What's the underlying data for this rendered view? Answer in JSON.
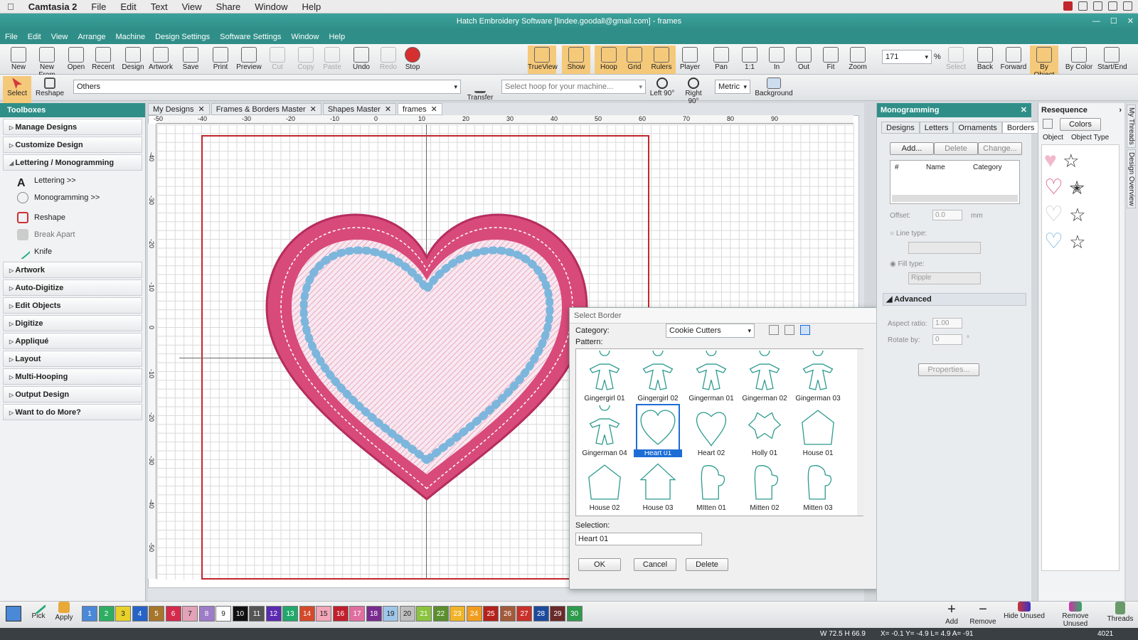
{
  "mac": {
    "apple": "",
    "app": "Camtasia 2",
    "menus": [
      "File",
      "Edit",
      "Text",
      "View",
      "Share",
      "Window",
      "Help"
    ]
  },
  "window": {
    "title": "Hatch Embroidery Software [lindee.goodall@gmail.com] - frames"
  },
  "menubar": [
    "File",
    "Edit",
    "View",
    "Arrange",
    "Machine",
    "Design Settings",
    "Software Settings",
    "Window",
    "Help"
  ],
  "toolbar": [
    {
      "label": "New",
      "icon": "new-icon"
    },
    {
      "label": "New From",
      "icon": "new-from-icon"
    },
    {
      "label": "Open",
      "icon": "open-icon"
    },
    {
      "label": "Recent",
      "icon": "recent-icon"
    },
    {
      "label": "Design",
      "icon": "design-icon"
    },
    {
      "label": "Artwork",
      "icon": "artwork-icon"
    },
    {
      "label": "Save",
      "icon": "save-icon"
    },
    {
      "label": "Print",
      "icon": "print-icon"
    },
    {
      "label": "Preview",
      "icon": "preview-icon"
    },
    {
      "label": "Cut",
      "icon": "cut-icon"
    },
    {
      "label": "Copy",
      "icon": "copy-icon"
    },
    {
      "label": "Paste",
      "icon": "paste-icon"
    },
    {
      "label": "Undo",
      "icon": "undo-icon"
    },
    {
      "label": "Redo",
      "icon": "redo-icon"
    },
    {
      "label": "Stop",
      "icon": "stop-icon"
    },
    {
      "label": "TrueView",
      "icon": "trueview-icon"
    },
    {
      "label": "Show",
      "icon": "show-icon"
    },
    {
      "label": "Hoop",
      "icon": "hoop-icon"
    },
    {
      "label": "Grid",
      "icon": "grid-icon"
    },
    {
      "label": "Rulers",
      "icon": "rulers-icon"
    },
    {
      "label": "Player",
      "icon": "player-icon"
    },
    {
      "label": "Pan",
      "icon": "pan-icon"
    },
    {
      "label": "1:1",
      "icon": "zoom-1-1-icon"
    },
    {
      "label": "In",
      "icon": "zoom-in-icon"
    },
    {
      "label": "Out",
      "icon": "zoom-out-icon"
    },
    {
      "label": "Fit",
      "icon": "fit-icon"
    },
    {
      "label": "Zoom",
      "icon": "zoom-icon"
    },
    {
      "label": "Select",
      "icon": "select-icon"
    },
    {
      "label": "Back",
      "icon": "back-icon"
    },
    {
      "label": "Forward",
      "icon": "forward-icon"
    },
    {
      "label": "By Object",
      "icon": "by-object-icon"
    },
    {
      "label": "By Color",
      "icon": "by-color-icon"
    },
    {
      "label": "Start/End",
      "icon": "start-end-icon"
    }
  ],
  "zoom": {
    "value": "171",
    "unit": "%"
  },
  "toolbar2": {
    "select": "Select",
    "reshape": "Reshape",
    "object_combo": "Others",
    "transfer": "Transfer",
    "hoop_placeholder": "Select hoop for your machine...",
    "left90": "Left 90°",
    "right90": "Right 90°",
    "units": "Metric",
    "background": "Background"
  },
  "toolboxes": {
    "title": "Toolboxes",
    "items": [
      "Manage Designs",
      "Customize Design",
      "Lettering / Monogramming"
    ],
    "subitems": [
      "Lettering >>",
      "Monogramming >>",
      "Reshape",
      "Break Apart",
      "Knife"
    ],
    "items2": [
      "Artwork",
      "Auto-Digitize",
      "Edit Objects",
      "Digitize",
      "Appliqué",
      "Layout",
      "Multi-Hooping",
      "Output Design",
      "Want to do More?"
    ]
  },
  "tabs": [
    "My Designs",
    "Frames & Borders Master",
    "Shapes Master",
    "frames"
  ],
  "rulers": {
    "h": [
      "-50",
      "-40",
      "-30",
      "-20",
      "-10",
      "0",
      "10",
      "20",
      "30",
      "40",
      "50",
      "60",
      "70",
      "80",
      "90"
    ],
    "v": [
      "-40",
      "-30",
      "-20",
      "-10",
      "0",
      "-10",
      "-20",
      "-30",
      "-40",
      "-50"
    ]
  },
  "dialog": {
    "title": "Select Border",
    "category_label": "Category:",
    "category": "Cookie Cutters",
    "pattern_label": "Pattern:",
    "patterns": [
      "Gingergirl 01",
      "Gingergirl 02",
      "Gingerman 01",
      "Gingerman 02",
      "Gingerman 03",
      "Gingerman 04",
      "Heart 01",
      "Heart 02",
      "Holly 01",
      "House 01",
      "House 02",
      "House 03",
      "MItten 01",
      "Mitten 02",
      "Mitten 03"
    ],
    "selection_label": "Selection:",
    "selection": "Heart 01",
    "ok": "OK",
    "cancel": "Cancel",
    "delete": "Delete"
  },
  "monog": {
    "title": "Monogramming",
    "tabs": [
      "Designs",
      "Letters",
      "Ornaments",
      "Borders"
    ],
    "add": "Add...",
    "delete": "Delete",
    "change": "Change...",
    "cols": [
      "#",
      "Name",
      "Category"
    ],
    "offset_label": "Offset:",
    "offset": "0.0",
    "offset_unit": "mm",
    "line_type": "Line type:",
    "fill_type": "Fill type:",
    "fill": "Ripple",
    "advanced": "Advanced",
    "aspect_label": "Aspect ratio:",
    "aspect": "1.00",
    "rotate_label": "Rotate by:",
    "rotate": "0",
    "rotate_unit": "°",
    "properties": "Properties..."
  },
  "reseq": {
    "title": "Resequence",
    "colors": "Colors",
    "object": "Object",
    "object_type": "Object Type"
  },
  "sidetabs": [
    "My Threads",
    "Design Overview"
  ],
  "bottom": {
    "pick": "Pick",
    "apply": "Apply",
    "add": "Add",
    "remove": "Remove",
    "hide_unused": "Hide Unused",
    "remove_unused": "Remove Unused",
    "threads": "Threads"
  },
  "swatches": [
    {
      "n": "1",
      "c": "#4a88d8"
    },
    {
      "n": "2",
      "c": "#2fae63"
    },
    {
      "n": "3",
      "c": "#e8d12a"
    },
    {
      "n": "4",
      "c": "#2563c9"
    },
    {
      "n": "5",
      "c": "#a6762d"
    },
    {
      "n": "6",
      "c": "#d42a4c"
    },
    {
      "n": "7",
      "c": "#e3a2b7"
    },
    {
      "n": "8",
      "c": "#9e7cc8"
    },
    {
      "n": "9",
      "c": "#ffffff"
    },
    {
      "n": "10",
      "c": "#111111"
    },
    {
      "n": "11",
      "c": "#555555"
    },
    {
      "n": "12",
      "c": "#5a2bb0"
    },
    {
      "n": "13",
      "c": "#21a86b"
    },
    {
      "n": "14",
      "c": "#d44a2a"
    },
    {
      "n": "15",
      "c": "#f2a6b8"
    },
    {
      "n": "16",
      "c": "#c21f2d"
    },
    {
      "n": "17",
      "c": "#e06fa0"
    },
    {
      "n": "18",
      "c": "#7a2b8f"
    },
    {
      "n": "19",
      "c": "#9ec6e8"
    },
    {
      "n": "20",
      "c": "#bfbfbf"
    },
    {
      "n": "21",
      "c": "#8ac43f"
    },
    {
      "n": "22",
      "c": "#5b8f2e"
    },
    {
      "n": "23",
      "c": "#f0b429"
    },
    {
      "n": "24",
      "c": "#f29c1f"
    },
    {
      "n": "25",
      "c": "#b5221c"
    },
    {
      "n": "26",
      "c": "#a35a3a"
    },
    {
      "n": "27",
      "c": "#c9312a"
    },
    {
      "n": "28",
      "c": "#1e4a9c"
    },
    {
      "n": "29",
      "c": "#6a2a2a"
    },
    {
      "n": "30",
      "c": "#2e9a4c"
    }
  ],
  "status": {
    "size": "W 72.5 H 66.9",
    "coords": "X= -0.1 Y= -4.9 L= 4.9 A= -91",
    "count": "4021"
  },
  "colors": {
    "teal": "#2f8f88",
    "hoop": "#c0262c",
    "heart": "#d84a7a",
    "bead": "#7cb6dc"
  }
}
